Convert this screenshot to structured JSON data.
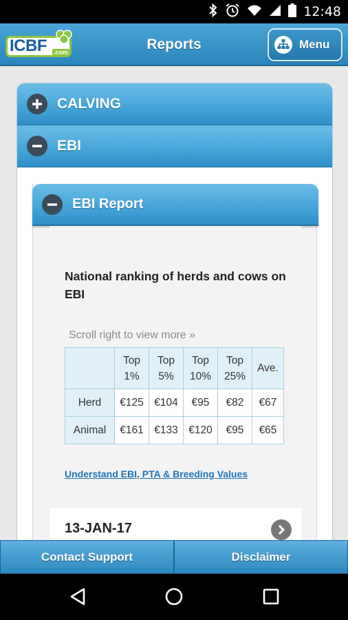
{
  "status_bar": {
    "time": "12:48",
    "icons": [
      "bluetooth-icon",
      "alarm-icon",
      "wifi-icon",
      "signal-icon",
      "battery-icon"
    ]
  },
  "header": {
    "logo_text": "ICBF",
    "logo_suffix": ".com",
    "title": "Reports",
    "menu_label": "Menu",
    "menu_icon": "sitemap-icon"
  },
  "accordions": [
    {
      "label": "CALVING",
      "state": "collapsed",
      "icon": "plus-icon"
    },
    {
      "label": "EBI",
      "state": "expanded",
      "icon": "minus-icon"
    }
  ],
  "ebi_report": {
    "title": "EBI Report",
    "icon": "minus-icon",
    "heading": "National ranking of herds and cows on EBI",
    "scroll_hint": "Scroll right to view more »",
    "table": {
      "columns": [
        "Top 1%",
        "Top 5%",
        "Top 10%",
        "Top 25%",
        "Ave."
      ],
      "rows": [
        {
          "label": "Herd",
          "values": [
            "€125",
            "€104",
            "€95",
            "€82",
            "€67"
          ]
        },
        {
          "label": "Animal",
          "values": [
            "€161",
            "€133",
            "€120",
            "€95",
            "€65"
          ]
        }
      ]
    },
    "link_text": "Understand EBI, PTA & Breeding Values",
    "date_entry": "13-JAN-17"
  },
  "bottom_bar": {
    "contact_label": "Contact Support",
    "disclaimer_label": "Disclaimer"
  },
  "colors": {
    "accent_blue": "#2f8fc7",
    "logo_green": "#8dc63f",
    "logo_navy": "#1b5e9e"
  }
}
